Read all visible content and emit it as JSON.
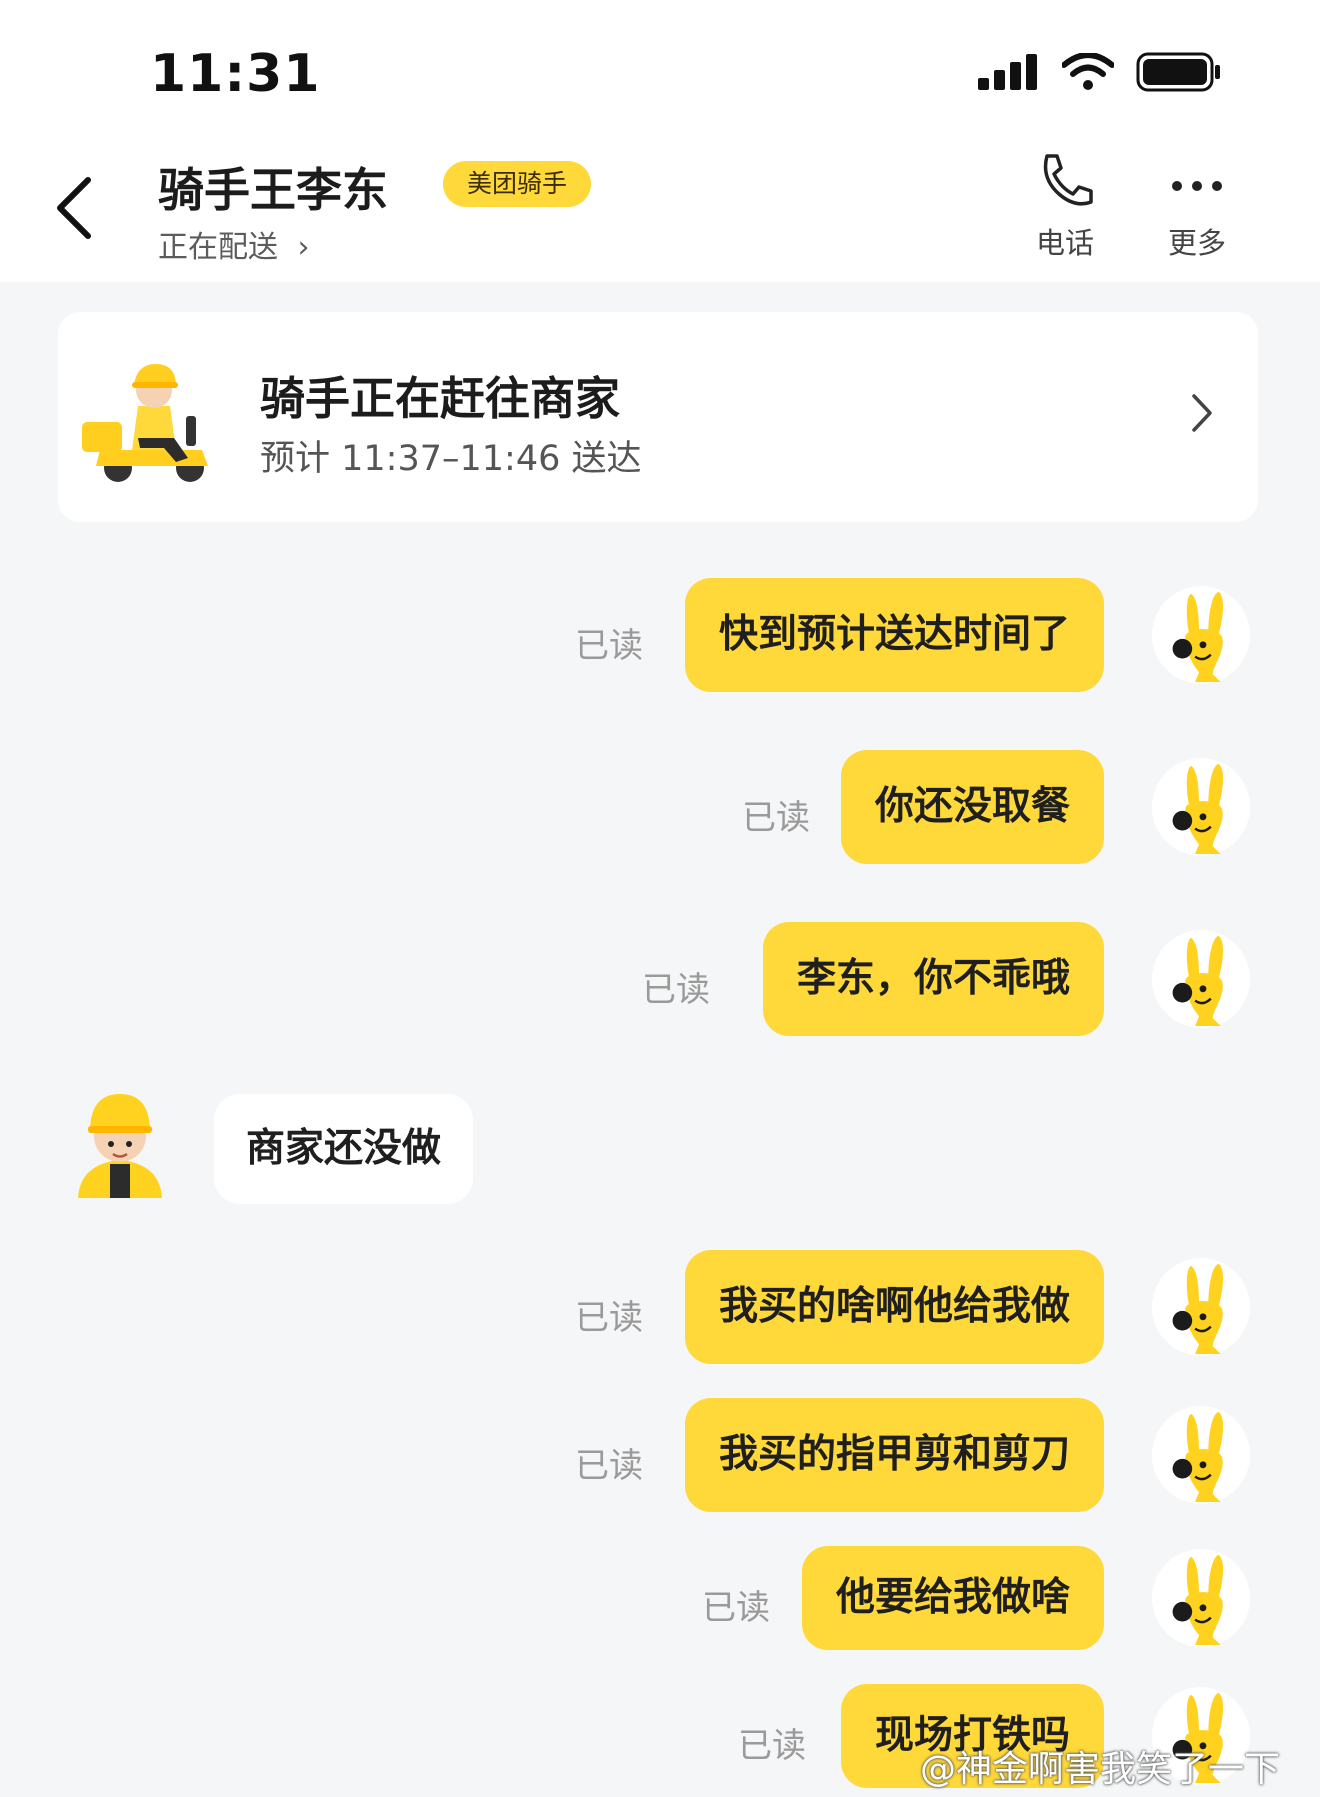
{
  "status_bar": {
    "time": "11:31"
  },
  "header": {
    "back_icon": "chevron-left-icon",
    "title": "骑手王李东",
    "badge": "美团骑手",
    "subtitle": "正在配送",
    "phone_label": "电话",
    "more_label": "更多",
    "accent_color": "#ffd83a"
  },
  "delivery_card": {
    "title": "骑手正在赶往商家",
    "eta": "预计 11:37–11:46 送达"
  },
  "messages": [
    {
      "from": "me",
      "text": "快到预计送达时间了",
      "status": "已读"
    },
    {
      "from": "me",
      "text": "你还没取餐",
      "status": "已读"
    },
    {
      "from": "me",
      "text": "李东，你不乖哦",
      "status": "已读"
    },
    {
      "from": "rider",
      "text": "商家还没做"
    },
    {
      "from": "me",
      "text": "我买的啥啊他给我做",
      "status": "已读"
    },
    {
      "from": "me",
      "text": "我买的指甲剪和剪刀",
      "status": "已读"
    },
    {
      "from": "me",
      "text": "他要给我做啥",
      "status": "已读"
    },
    {
      "from": "me",
      "text": "现场打铁吗",
      "status": "已读"
    }
  ],
  "watermark": "@神金啊害我笑了一下"
}
